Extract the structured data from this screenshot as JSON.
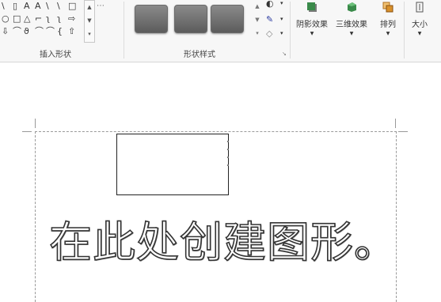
{
  "ribbon": {
    "insert_shapes": {
      "group_label": "插入形状",
      "shape_rows": [
        [
          "\\",
          "▯",
          "A",
          "A",
          "\\",
          "\\",
          "□"
        ],
        [
          "○",
          "□",
          "△",
          "⌐",
          "ʅ",
          "ʅ",
          "⇨"
        ],
        [
          "⇩",
          "⌒",
          "ϑ",
          "⌒",
          "⌒",
          "{",
          "⇧"
        ]
      ],
      "scroll": [
        "▲",
        "▼",
        "▾"
      ]
    },
    "shape_styles": {
      "group_label": "形状样式",
      "swatch_count": 3,
      "scroll": [
        "▲",
        "▼",
        "▾"
      ]
    },
    "format_buttons": [
      "▾",
      "▾",
      "▾"
    ],
    "arrange_buttons": [
      {
        "label": "阴影效果",
        "icon": "shadow-effect-icon",
        "color": "#3a8a4a"
      },
      {
        "label": "三维效果",
        "icon": "3d-effect-icon",
        "color": "#3a8a4a"
      },
      {
        "label": "排列",
        "icon": "arrange-icon",
        "color": "#d8902a"
      },
      {
        "label": "大小",
        "icon": "size-icon",
        "color": "#555555"
      }
    ]
  },
  "document": {
    "heading": "在此处创建图形。"
  }
}
